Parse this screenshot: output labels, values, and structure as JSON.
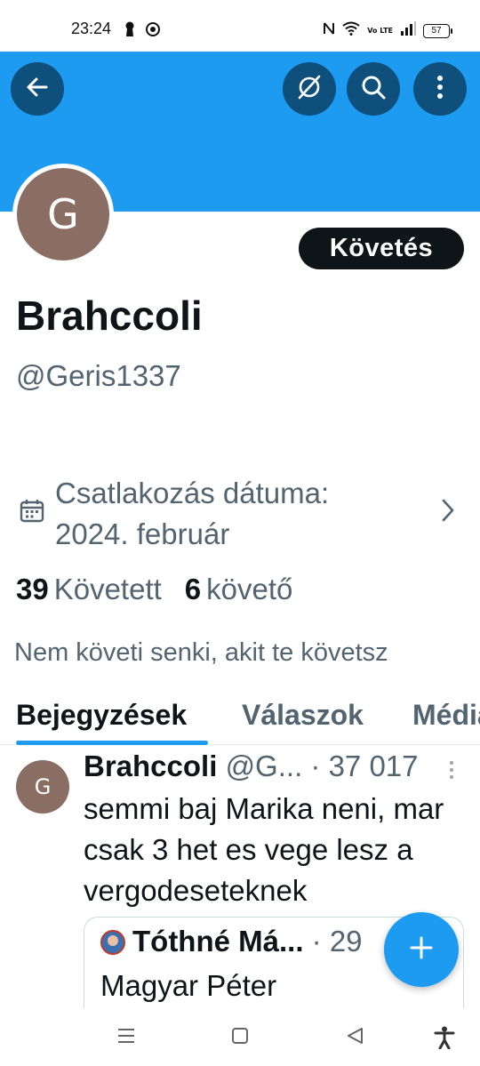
{
  "status_bar": {
    "time": "23:24",
    "left_icons": [
      "keyhole-icon",
      "chrome-icon"
    ],
    "right_icons": [
      "nfc-icon",
      "wifi-icon",
      "volte-icon",
      "signal-icon",
      "battery-icon"
    ],
    "volte_text": "Vo LTE",
    "battery": "57"
  },
  "header": {
    "banner_color": "#1d9bf0",
    "buttons": [
      "back-arrow-icon",
      "grok-icon",
      "search-icon",
      "more-vertical-icon"
    ]
  },
  "profile": {
    "avatar_letter": "G",
    "avatar_color": "#8a6e64",
    "follow_label": "Követés",
    "display_name": "Brahccoli",
    "handle": "@Geris1337",
    "joined_text": "Csatlakozás dátuma: 2024. február",
    "following_count": "39",
    "following_label": "Követett",
    "followers_count": "6",
    "followers_label": "követő",
    "no_mutuals": "Nem követi senki, akit te követsz"
  },
  "tabs": [
    {
      "label": "Bejegyzések",
      "active": true
    },
    {
      "label": "Válaszok",
      "active": false
    },
    {
      "label": "Média",
      "active": false
    }
  ],
  "post": {
    "avatar_letter": "G",
    "author_name": "Brahccoli",
    "author_handle_truncated": "@G...",
    "views_meta": "· 37 017",
    "text": "semmi baj Marika neni, mar csak 3 het es vege lesz a vergodeseteknek",
    "quote": {
      "author_name": "Tóthné Má...",
      "meta": "· 29",
      "text": "Magyar Péter"
    }
  },
  "fab": {
    "icon": "plus-icon"
  },
  "nav_bar": {
    "icons": [
      "recents-icon",
      "home-icon",
      "back-triangle-icon",
      "accessibility-icon"
    ]
  },
  "colors": {
    "accent": "#1d9bf0",
    "dark_button": "#0e4f7c",
    "text_primary": "#0f1419",
    "text_secondary": "#536471"
  }
}
